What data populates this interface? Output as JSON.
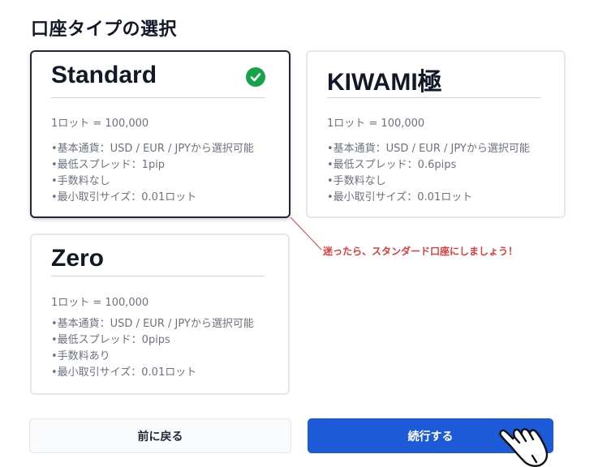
{
  "page": {
    "title": "口座タイプの選択"
  },
  "cards": [
    {
      "name": "Standard",
      "selected": true,
      "lot": "1ロット = 100,000",
      "specs": [
        "•基本通貨：USD / EUR / JPYから選択可能",
        "•最低スプレッド：1pip",
        "•手数料なし",
        "•最小取引サイズ：0.01ロット"
      ]
    },
    {
      "name": "KIWAMI極",
      "selected": false,
      "lot": "1ロット = 100,000",
      "specs": [
        "•基本通貨：USD / EUR / JPYから選択可能",
        "•最低スプレッド：0.6pips",
        "•手数料なし",
        "•最小取引サイズ：0.01ロット"
      ]
    },
    {
      "name": "Zero",
      "selected": false,
      "lot": "1ロット = 100,000",
      "specs": [
        "•基本通貨：USD / EUR / JPYから選択可能",
        "•最低スプレッド：0pips",
        "•手数料あり",
        "•最小取引サイズ：0.01ロット"
      ]
    }
  ],
  "annotation": {
    "text": "迷ったら、スタンダード口座にしましょう！",
    "color": "#e03a3a"
  },
  "buttons": {
    "back_label": "前に戻る",
    "continue_label": "続行する"
  },
  "colors": {
    "primary": "#1d5ad8",
    "check": "#16a34a",
    "selected_border": "#1f2937"
  },
  "icons": {
    "check": "check-circle-icon",
    "pointer": "hand-pointer-icon"
  }
}
